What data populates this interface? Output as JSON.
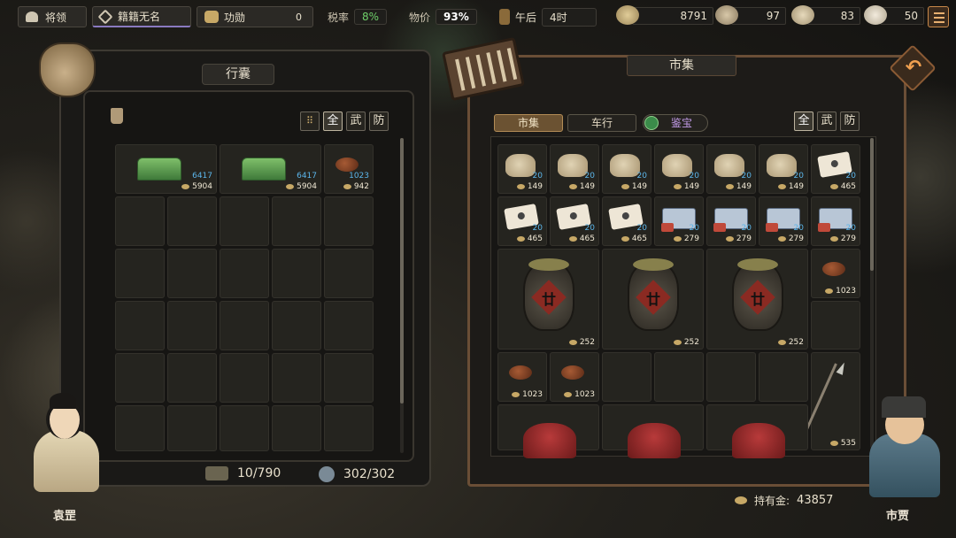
{
  "top_bar": {
    "general_label": "将领",
    "name_label": "籍籍无名",
    "merit_label": "功勋",
    "merit_value": "0",
    "tax_label": "税率",
    "tax_value": "8%",
    "price_label": "物价",
    "price_value": "93%",
    "time_of_day": "午后",
    "hour": "4时",
    "resources": [
      {
        "icon": "coin-stack-icon",
        "value": "8791"
      },
      {
        "icon": "horse-icon",
        "value": "97"
      },
      {
        "icon": "grain-sack-icon",
        "value": "83"
      },
      {
        "icon": "scroll-icon",
        "value": "50"
      }
    ]
  },
  "inventory": {
    "title": "行囊",
    "filters": [
      "全",
      "武",
      "防"
    ],
    "active_filter": "全",
    "items": [
      {
        "icon": "jade-tablet-icon",
        "count": "6417",
        "price": "5904"
      },
      {
        "icon": "jade-tablet-icon",
        "count": "6417",
        "price": "5904"
      },
      {
        "icon": "bean-icon",
        "count": "1023",
        "price": "942"
      }
    ],
    "weight": "10/790",
    "capacity": "302/302"
  },
  "market": {
    "title": "市集",
    "tabs": [
      "市集",
      "车行",
      "鉴宝"
    ],
    "active_tab": "市集",
    "filters": [
      "全",
      "武",
      "防"
    ],
    "active_filter": "全",
    "row1": [
      {
        "icon": "grain-sack-icon",
        "count": "20",
        "price": "149"
      },
      {
        "icon": "grain-sack-icon",
        "count": "20",
        "price": "149"
      },
      {
        "icon": "grain-sack-icon",
        "count": "20",
        "price": "149"
      },
      {
        "icon": "grain-sack-icon",
        "count": "20",
        "price": "149"
      },
      {
        "icon": "grain-sack-icon",
        "count": "20",
        "price": "149"
      },
      {
        "icon": "grain-sack-icon",
        "count": "20",
        "price": "149"
      },
      {
        "icon": "paper-scroll-icon",
        "count": "20",
        "price": "465"
      }
    ],
    "row2": [
      {
        "icon": "paper-scroll-icon",
        "count": "20",
        "price": "465"
      },
      {
        "icon": "paper-scroll-icon",
        "count": "20",
        "price": "465"
      },
      {
        "icon": "paper-scroll-icon",
        "count": "20",
        "price": "465"
      },
      {
        "icon": "tea-brick-icon",
        "count": "20",
        "price": "279"
      },
      {
        "icon": "tea-brick-icon",
        "count": "20",
        "price": "279"
      },
      {
        "icon": "tea-brick-icon",
        "count": "20",
        "price": "279"
      },
      {
        "icon": "tea-brick-icon",
        "count": "20",
        "price": "279"
      }
    ],
    "jars": [
      {
        "icon": "wine-jar-icon",
        "seal": "廿",
        "price": "252"
      },
      {
        "icon": "wine-jar-icon",
        "seal": "廿",
        "price": "252"
      },
      {
        "icon": "wine-jar-icon",
        "seal": "廿",
        "price": "252"
      }
    ],
    "side_bean": {
      "icon": "bean-icon",
      "price": "1023"
    },
    "beans": [
      {
        "icon": "bean-icon",
        "price": "1023"
      },
      {
        "icon": "bean-icon",
        "price": "1023"
      }
    ],
    "spear": {
      "icon": "spear-icon",
      "price": "535"
    },
    "owned_gold_label": "持有金:",
    "owned_gold": "43857"
  },
  "characters": {
    "player_name": "袁罡",
    "merchant_name": "市贾"
  }
}
